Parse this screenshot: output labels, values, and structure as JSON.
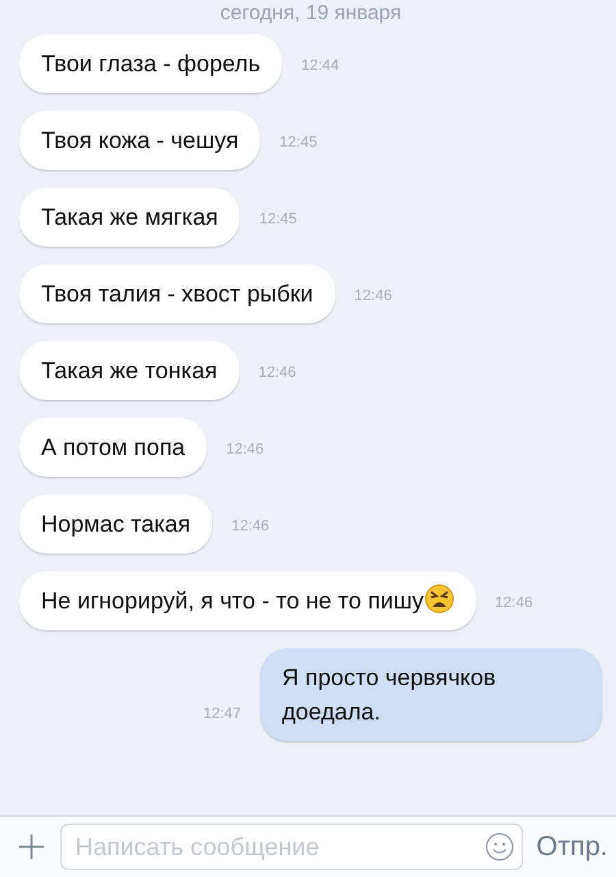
{
  "date_divider": "сегодня, 19 января",
  "messages": [
    {
      "kind": "incoming",
      "text": "Твои глаза - форель",
      "time": "12:44"
    },
    {
      "kind": "incoming",
      "text": "Твоя кожа - чешуя",
      "time": "12:45"
    },
    {
      "kind": "incoming",
      "text": "Такая же мягкая",
      "time": "12:45"
    },
    {
      "kind": "incoming",
      "text": "Твоя талия - хвост рыбки",
      "time": "12:46"
    },
    {
      "kind": "incoming",
      "text": "Такая же тонкая",
      "time": "12:46"
    },
    {
      "kind": "incoming",
      "text": "А потом попа",
      "time": "12:46"
    },
    {
      "kind": "incoming",
      "text": "Нормас такая",
      "time": "12:46"
    },
    {
      "kind": "incoming",
      "text": "Не игнорируй, я что - то не то пишу",
      "time": "12:46",
      "emoji": true
    },
    {
      "kind": "outgoing",
      "text": "Я просто червячков доедала.",
      "time": "12:47"
    }
  ],
  "composer": {
    "placeholder": "Написать сообщение",
    "send": "Отпр."
  }
}
